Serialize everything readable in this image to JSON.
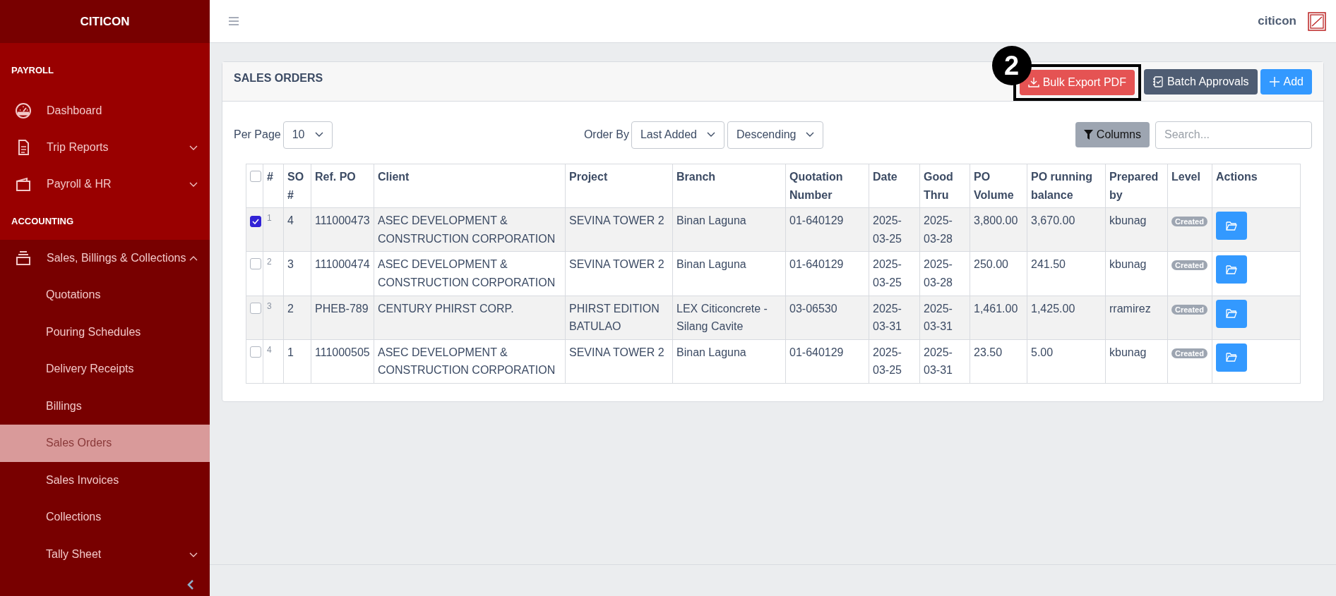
{
  "brand": "CITICON",
  "sidebar": {
    "sections": [
      {
        "heading": "PAYROLL",
        "items": [
          {
            "label": "Dashboard",
            "kind": "link"
          },
          {
            "label": "Trip Reports",
            "kind": "group",
            "expanded": false
          },
          {
            "label": "Payroll & HR",
            "kind": "group",
            "expanded": false
          }
        ]
      },
      {
        "heading": "ACCOUNTING",
        "items": [
          {
            "label": "Sales, Billings & Collections",
            "kind": "group",
            "expanded": true,
            "children": [
              {
                "label": "Quotations",
                "kind": "link",
                "selected": false
              },
              {
                "label": "Pouring Schedules",
                "kind": "link",
                "selected": false
              },
              {
                "label": "Delivery Receipts",
                "kind": "link",
                "selected": false
              },
              {
                "label": "Billings",
                "kind": "link",
                "selected": false
              },
              {
                "label": "Sales Orders",
                "kind": "link",
                "selected": true
              },
              {
                "label": "Sales Invoices",
                "kind": "link",
                "selected": false
              },
              {
                "label": "Collections",
                "kind": "link",
                "selected": false
              },
              {
                "label": "Tally Sheet",
                "kind": "group",
                "expanded": false,
                "selected": false
              }
            ]
          }
        ]
      }
    ]
  },
  "header": {
    "user": "citicon"
  },
  "card": {
    "title": "SALES ORDERS",
    "buttons": [
      {
        "label": "Bulk Export PDF",
        "kind": "export",
        "annotation": "2"
      },
      {
        "label": "Batch Approvals",
        "kind": "approvals"
      },
      {
        "label": "Add",
        "kind": "add"
      }
    ],
    "per_page": {
      "label": "Per Page",
      "value": "10"
    },
    "order_by": {
      "label": "Order By",
      "field": "Last Added",
      "direction": "Descending"
    },
    "columns_button": "Columns",
    "search": {
      "placeholder": "Search..."
    },
    "table": {
      "columns": [
        "#",
        "SO #",
        "Ref. PO",
        "Client",
        "Project",
        "Branch",
        "Quotation Number",
        "Date",
        "Good Thru",
        "PO Volume",
        "PO running balance",
        "Prepared by",
        "Level",
        "Actions"
      ],
      "header_checked": false,
      "rows": [
        {
          "checked": true,
          "cells": [
            "1",
            "4",
            "111000473",
            "ASEC DEVELOPMENT & CONSTRUCTION CORPORATION",
            "SEVINA TOWER 2",
            "Binan Laguna",
            "01-640129",
            "2025-03-25",
            "2025-03-28",
            "3,800.00",
            "3,670.00",
            "kbunag"
          ],
          "level": "Created"
        },
        {
          "checked": false,
          "cells": [
            "2",
            "3",
            "111000474",
            "ASEC DEVELOPMENT & CONSTRUCTION CORPORATION",
            "SEVINA TOWER 2",
            "Binan Laguna",
            "01-640129",
            "2025-03-25",
            "2025-03-28",
            "250.00",
            "241.50",
            "kbunag"
          ],
          "level": "Created"
        },
        {
          "checked": false,
          "cells": [
            "3",
            "2",
            "PHEB-789",
            "CENTURY PHIRST CORP.",
            "PHIRST EDITION BATULAO",
            "LEX Citiconcrete - Silang Cavite",
            "03-06530",
            "2025-03-31",
            "2025-03-31",
            "1,461.00",
            "1,425.00",
            "rramirez"
          ],
          "level": "Created"
        },
        {
          "checked": false,
          "cells": [
            "4",
            "1",
            "111000505",
            "ASEC DEVELOPMENT & CONSTRUCTION CORPORATION",
            "SEVINA TOWER 2",
            "Binan Laguna",
            "01-640129",
            "2025-03-25",
            "2025-03-31",
            "23.50",
            "5.00",
            "kbunag"
          ],
          "level": "Created"
        }
      ]
    }
  }
}
